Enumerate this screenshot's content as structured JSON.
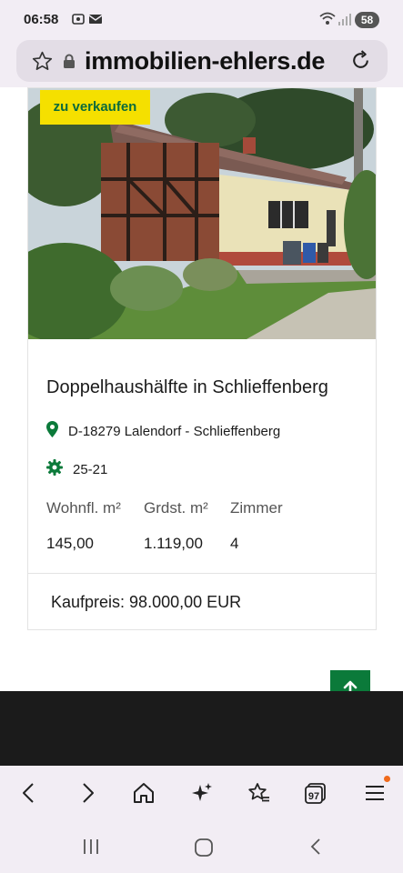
{
  "status_bar": {
    "time": "06:58",
    "battery": "58"
  },
  "browser": {
    "url": "immobilien-ehlers.de"
  },
  "listing": {
    "badge": "zu verkaufen",
    "title": "Doppelhaushälfte in Schlieffenberg",
    "location": "D-18279 Lalendorf - Schlieffenberg",
    "object_id": "25-21",
    "stats": [
      {
        "label": "Wohnfl. m²",
        "value": "145,00"
      },
      {
        "label": "Grdst. m²",
        "value": "1.119,00"
      },
      {
        "label": "Zimmer",
        "value": "4"
      }
    ],
    "price": "Kaufpreis: 98.000,00 EUR"
  },
  "toolbar": {
    "tabs_count": "97"
  },
  "colors": {
    "brand_green": "#0b7a3a",
    "badge_yellow": "#f5e000",
    "footer": "#1b1b1b"
  },
  "icons": [
    "location-pin-icon",
    "gear-icon",
    "arrow-up-icon",
    "star-icon",
    "lock-icon",
    "reload-icon",
    "home-icon",
    "sparkle-icon",
    "menu-icon"
  ]
}
